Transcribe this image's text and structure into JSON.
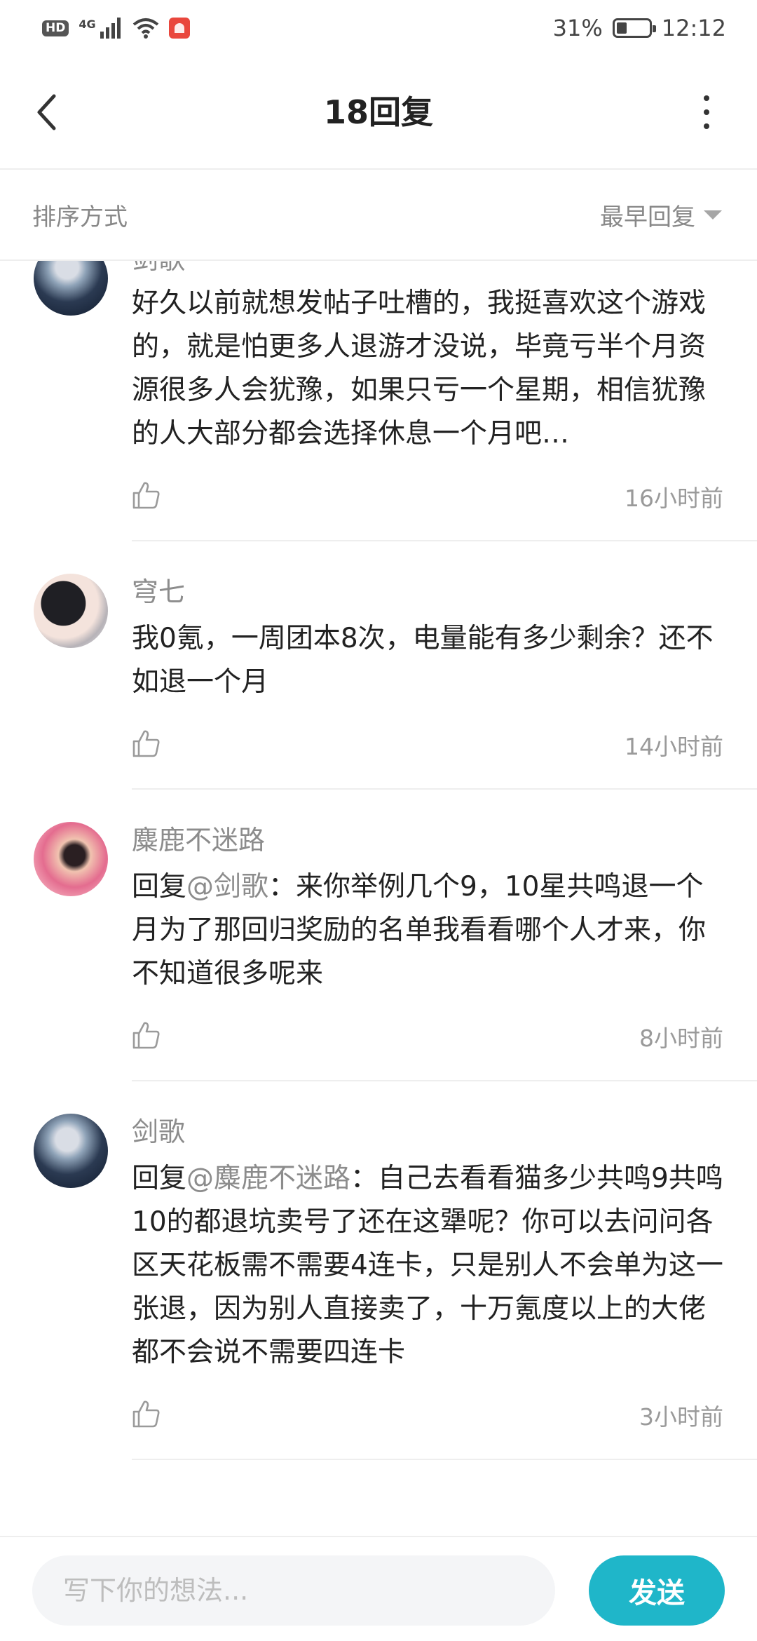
{
  "status_bar": {
    "hd_badge": "HD",
    "network": "4G",
    "battery_percent": "31%",
    "battery_level": 0.31,
    "time": "12:12"
  },
  "header": {
    "title": "18回复"
  },
  "sort": {
    "label": "排序方式",
    "selected": "最早回复"
  },
  "comments": [
    {
      "user": "剑歌",
      "body": "好久以前就想发帖子吐槽的，我挺喜欢这个游戏的，就是怕更多人退游才没说，毕竟亏半个月资源很多人会犹豫，如果只亏一个星期，相信犹豫的人大部分都会选择休息一个月吧…",
      "time": "16小时前"
    },
    {
      "user": "穹七",
      "body": "我0氪，一周团本8次，电量能有多少剩余？还不如退一个月",
      "time": "14小时前"
    },
    {
      "user": "麋鹿不迷路",
      "reply_prefix": "回复",
      "mention": "@剑歌",
      "body": "：来你举例几个9，10星共鸣退一个月为了那回归奖励的名单我看看哪个人才来，你不知道很多呢来",
      "time": "8小时前"
    },
    {
      "user": "剑歌",
      "reply_prefix": "回复",
      "mention": "@麋鹿不迷路",
      "body": "：自己去看看猫多少共鸣9共鸣10的都退坑卖号了还在这犟呢？你可以去问问各区天花板需不需要4连卡，只是别人不会单为这一张退，因为别人直接卖了，十万氪度以上的大佬都不会说不需要四连卡",
      "time": "3小时前"
    }
  ],
  "composer": {
    "placeholder": "写下你的想法...",
    "send_label": "发送"
  }
}
